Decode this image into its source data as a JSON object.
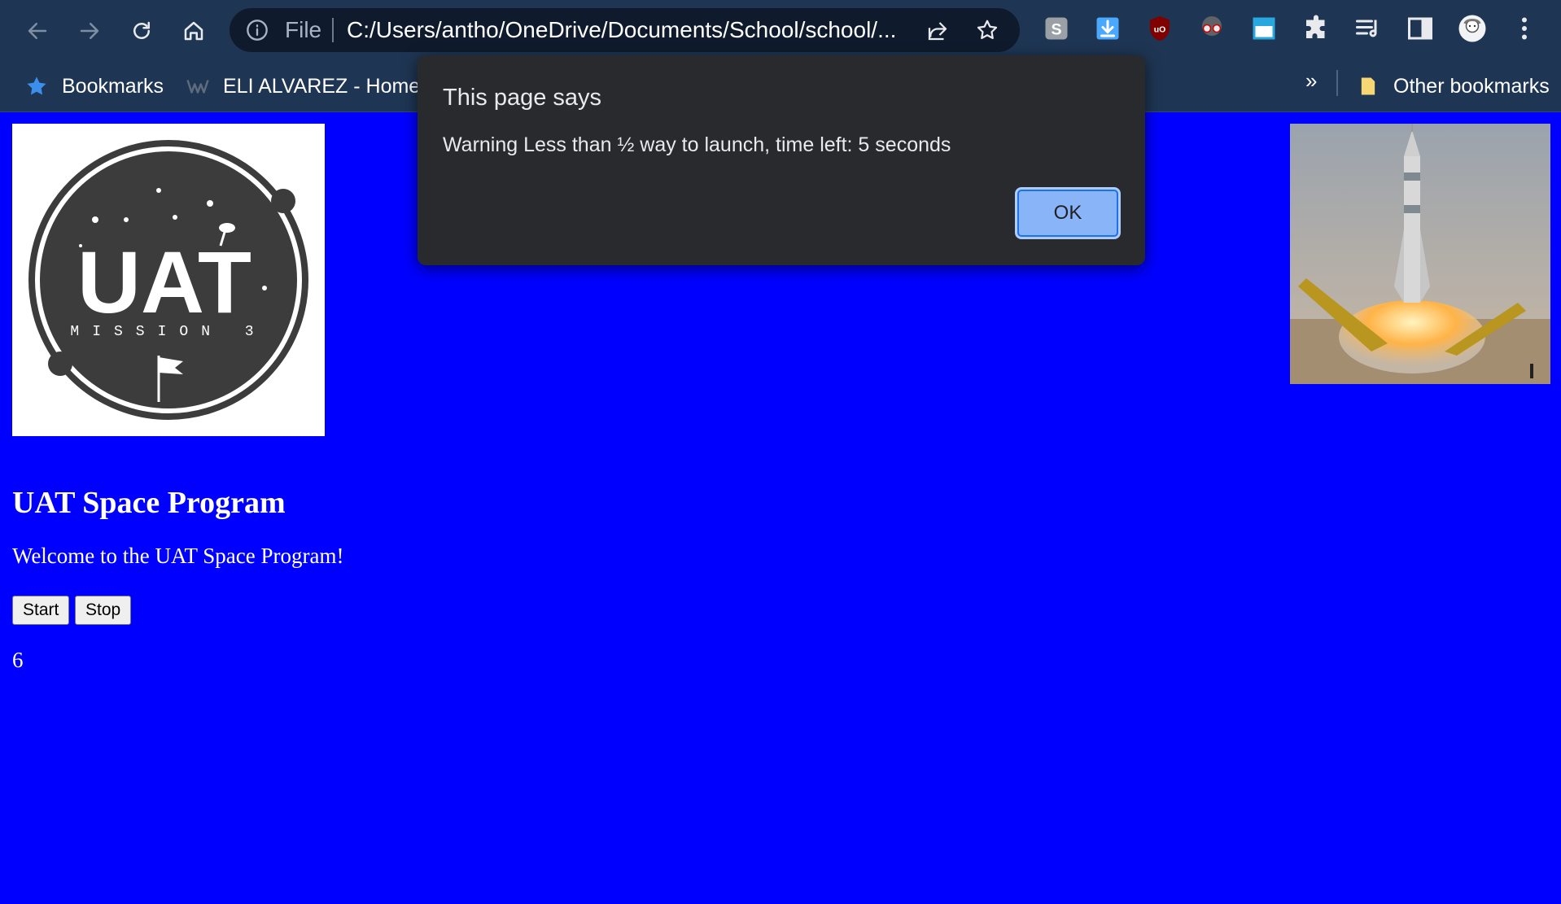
{
  "browser": {
    "omnibox": {
      "scheme_label": "File",
      "url": "C:/Users/antho/OneDrive/Documents/School/school/..."
    },
    "bookmarks_bar": {
      "items": [
        {
          "label": "Bookmarks",
          "icon": "star-icon"
        },
        {
          "label": "ELI ALVAREZ - Home",
          "icon": "weebly-w-icon"
        }
      ],
      "overflow_label": "»",
      "other_label": "Other bookmarks"
    },
    "extensions": [
      "s-extension-icon",
      "download-icon",
      "ublock-icon",
      "spy-glasses-icon",
      "window-extension-icon",
      "puzzle-icon",
      "reading-list-icon",
      "side-panel-icon",
      "profile-avatar",
      "kebab-menu-icon"
    ]
  },
  "page": {
    "logo": {
      "brand": "UAT",
      "subtitle": "MISSION 3"
    },
    "title": "UAT Space Program",
    "welcome": "Welcome to the UAT Space Program!",
    "buttons": {
      "start": "Start",
      "stop": "Stop"
    },
    "countdown_value": "6",
    "background_color": "#0000ff"
  },
  "dialog": {
    "title": "This page says",
    "message": "Warning Less than ½ way to launch, time left: 5 seconds",
    "ok_label": "OK"
  },
  "colors": {
    "chrome_bg": "#1e3553",
    "dialog_bg": "#292a2d",
    "ok_button": "#8ab4f8"
  }
}
